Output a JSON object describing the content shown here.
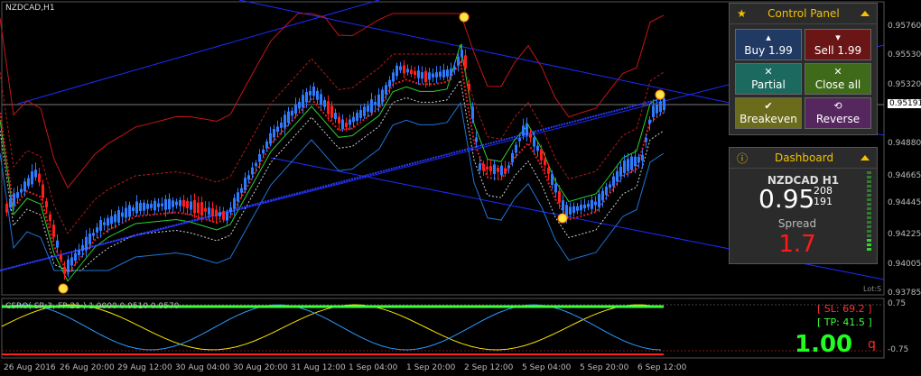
{
  "chart": {
    "title": "NZDCAD,H1",
    "indicator_title": "CSRO( SR:3, FP:21 ) 1.0000 0.9510 0.9570",
    "price_axis": [
      "0.95760",
      "0.95530",
      "0.95320",
      "0.95191",
      "0.94880",
      "0.94665",
      "0.94445",
      "0.94225",
      "0.94005",
      "0.93785"
    ],
    "current_price_label": "0.95191",
    "ind_axis": [
      "0.75",
      "-0.75"
    ],
    "time_axis": [
      "26 Aug 2016",
      "26 Aug 20:00",
      "29 Aug 12:00",
      "30 Aug 04:00",
      "30 Aug 20:00",
      "31 Aug 12:00",
      "1 Sep 04:00",
      "1 Sep 20:00",
      "2 Sep 12:00",
      "5 Sep 04:00",
      "5 Sep 20:00",
      "6 Sep 12:00"
    ]
  },
  "control_panel": {
    "title": "Control Panel",
    "buttons": {
      "buy": "Buy 1.99",
      "sell": "Sell 1.99",
      "partial": "Partial",
      "close_all": "Close all",
      "breakeven": "Breakeven",
      "reverse": "Reverse"
    },
    "glyphs": {
      "buy": "▴",
      "sell": "▾",
      "partial": "✕",
      "close_all": "✕",
      "breakeven": "✔",
      "reverse": "⟲"
    }
  },
  "dashboard": {
    "title": "Dashboard",
    "symbol": "NZDCAD H1",
    "price_main": "0.95",
    "ask_digits": "208",
    "bid_digits": "191",
    "spread_label": "Spread",
    "spread_value": "1.7"
  },
  "trade_info": {
    "sl": "[ SL: 69.2 ]",
    "tp": "[ TP: 41.5 ]",
    "lots": "1.00",
    "q": "q",
    "small_label": "Lot:S"
  },
  "colors": {
    "bull": "#2e7bff",
    "bear": "#ff1d1d",
    "panel_accent": "#f2c200"
  }
}
